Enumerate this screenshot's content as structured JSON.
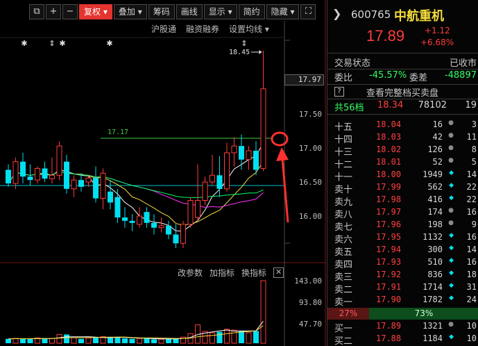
{
  "toolbar": {
    "buttons": [
      "+",
      "−",
      "复权",
      "叠加",
      "筹码",
      "画线",
      "显示",
      "简约",
      "隐藏"
    ],
    "active": "复权"
  },
  "sub_toolbar": [
    "沪股通",
    "融资融券",
    "设置均线"
  ],
  "indicator_toolbar": [
    "改参数",
    "加指标",
    "换指标"
  ],
  "chart": {
    "high_label": "18.45",
    "ma_label": "17.17",
    "price_tag": "17.97",
    "price_axis": [
      "17.50",
      "17.00",
      "16.50",
      "16.00"
    ],
    "volume_axis": [
      "143.00",
      "93.80",
      "47.70"
    ],
    "candles": [
      {
        "o": 16.7,
        "h": 16.78,
        "l": 16.45,
        "c": 16.5
      },
      {
        "o": 16.5,
        "h": 16.88,
        "l": 16.42,
        "c": 16.82
      },
      {
        "o": 16.82,
        "h": 16.95,
        "l": 16.5,
        "c": 16.6
      },
      {
        "o": 16.6,
        "h": 16.78,
        "l": 16.47,
        "c": 16.55
      },
      {
        "o": 16.55,
        "h": 16.75,
        "l": 16.5,
        "c": 16.72
      },
      {
        "o": 16.72,
        "h": 16.82,
        "l": 16.52,
        "c": 16.57
      },
      {
        "o": 16.57,
        "h": 16.88,
        "l": 16.5,
        "c": 16.62
      },
      {
        "o": 16.62,
        "h": 17.12,
        "l": 16.55,
        "c": 17.05
      },
      {
        "o": 16.82,
        "h": 16.92,
        "l": 16.35,
        "c": 16.42
      },
      {
        "o": 16.42,
        "h": 16.62,
        "l": 16.3,
        "c": 16.55
      },
      {
        "o": 16.55,
        "h": 16.65,
        "l": 16.38,
        "c": 16.45
      },
      {
        "o": 16.52,
        "h": 16.62,
        "l": 16.45,
        "c": 16.58
      },
      {
        "o": 16.58,
        "h": 16.75,
        "l": 16.22,
        "c": 16.28
      },
      {
        "o": 16.28,
        "h": 16.72,
        "l": 16.12,
        "c": 16.65
      },
      {
        "o": 16.38,
        "h": 16.55,
        "l": 16.12,
        "c": 16.22
      },
      {
        "o": 16.3,
        "h": 16.42,
        "l": 15.92,
        "c": 16.0
      },
      {
        "o": 16.0,
        "h": 16.15,
        "l": 15.85,
        "c": 15.95
      },
      {
        "o": 15.95,
        "h": 16.05,
        "l": 15.8,
        "c": 15.92
      },
      {
        "o": 15.9,
        "h": 16.15,
        "l": 15.85,
        "c": 16.02
      },
      {
        "o": 16.08,
        "h": 16.15,
        "l": 15.85,
        "c": 15.92
      },
      {
        "o": 15.92,
        "h": 16.05,
        "l": 15.75,
        "c": 15.85
      },
      {
        "o": 15.85,
        "h": 16.0,
        "l": 15.78,
        "c": 15.88
      },
      {
        "o": 15.88,
        "h": 15.95,
        "l": 15.68,
        "c": 15.75
      },
      {
        "o": 15.75,
        "h": 15.9,
        "l": 15.55,
        "c": 15.62
      },
      {
        "o": 15.62,
        "h": 15.95,
        "l": 15.55,
        "c": 15.9
      },
      {
        "o": 15.9,
        "h": 16.3,
        "l": 15.85,
        "c": 16.25
      },
      {
        "o": 16.0,
        "h": 16.78,
        "l": 15.95,
        "c": 16.25
      },
      {
        "o": 16.25,
        "h": 16.6,
        "l": 16.18,
        "c": 16.52
      },
      {
        "o": 16.52,
        "h": 16.92,
        "l": 16.48,
        "c": 16.62
      },
      {
        "o": 16.62,
        "h": 16.9,
        "l": 16.3,
        "c": 16.42
      },
      {
        "o": 16.42,
        "h": 17.1,
        "l": 16.38,
        "c": 16.95
      },
      {
        "o": 16.95,
        "h": 17.18,
        "l": 16.75,
        "c": 17.05
      },
      {
        "o": 17.05,
        "h": 17.22,
        "l": 16.7,
        "c": 16.85
      },
      {
        "o": 16.85,
        "h": 17.05,
        "l": 16.7,
        "c": 16.98
      },
      {
        "o": 16.98,
        "h": 17.12,
        "l": 16.62,
        "c": 16.7
      },
      {
        "o": 16.72,
        "h": 18.45,
        "l": 16.68,
        "c": 17.89
      }
    ],
    "volumes": [
      10,
      11,
      10,
      10,
      12,
      10,
      11,
      20,
      20,
      13,
      10,
      12,
      14,
      15,
      13,
      14,
      11,
      10,
      11,
      11,
      9,
      9,
      10,
      11,
      14,
      22,
      42,
      27,
      24,
      26,
      32,
      30,
      28,
      24,
      28,
      143
    ]
  },
  "sidebar": {
    "code": "600765",
    "name": "中航重机",
    "price": "17.89",
    "change": "+1.12",
    "change_pct": "+6.68%",
    "status_label": "交易状态",
    "status_value": "已收市",
    "weibi_label": "委比",
    "weibi_value": "-45.57%",
    "weicha_label": "委差",
    "weicha_value": "-48897",
    "full_book_label": "查看完整档买卖盘",
    "levels_label": "共56档",
    "levels_price": "18.34",
    "levels_vol": "78102",
    "levels_cnt": "19",
    "ask": [
      {
        "label": "十五",
        "price": "18.04",
        "vol": "16",
        "mark": "●",
        "cnt": "3"
      },
      {
        "label": "十四",
        "price": "18.03",
        "vol": "42",
        "mark": "●",
        "cnt": "11"
      },
      {
        "label": "十三",
        "price": "18.02",
        "vol": "126",
        "mark": "●",
        "cnt": "8"
      },
      {
        "label": "十二",
        "price": "18.01",
        "vol": "52",
        "mark": "●",
        "cnt": "5"
      },
      {
        "label": "十一",
        "price": "18.00",
        "vol": "1949",
        "mark": "◆",
        "cnt": "14"
      },
      {
        "label": "卖十",
        "price": "17.99",
        "vol": "562",
        "mark": "◆",
        "cnt": "22"
      },
      {
        "label": "卖九",
        "price": "17.98",
        "vol": "416",
        "mark": "◆",
        "cnt": "22"
      },
      {
        "label": "卖八",
        "price": "17.97",
        "vol": "174",
        "mark": "●",
        "cnt": "16"
      },
      {
        "label": "卖七",
        "price": "17.96",
        "vol": "198",
        "mark": "●",
        "cnt": "9"
      },
      {
        "label": "卖六",
        "price": "17.95",
        "vol": "1132",
        "mark": "◆",
        "cnt": "16"
      },
      {
        "label": "卖五",
        "price": "17.94",
        "vol": "300",
        "mark": "◆",
        "cnt": "14"
      },
      {
        "label": "卖四",
        "price": "17.93",
        "vol": "510",
        "mark": "◆",
        "cnt": "16"
      },
      {
        "label": "卖三",
        "price": "17.92",
        "vol": "836",
        "mark": "◆",
        "cnt": "18"
      },
      {
        "label": "卖二",
        "price": "17.91",
        "vol": "1714",
        "mark": "◆",
        "cnt": "31"
      },
      {
        "label": "卖一",
        "price": "17.90",
        "vol": "1782",
        "mark": "◆",
        "cnt": "24"
      }
    ],
    "ratio_left": "27%",
    "ratio_right": "73%",
    "bid": [
      {
        "label": "买一",
        "price": "17.89",
        "vol": "1321",
        "mark": "●",
        "cnt": "10"
      },
      {
        "label": "买二",
        "price": "17.88",
        "vol": "1184",
        "mark": "◆",
        "cnt": "10"
      }
    ]
  },
  "colors": {
    "up": "#ff3c3c",
    "down": "#00e0f0",
    "ma5": "#ffffff",
    "ma10": "#f5dc3c",
    "ma20": "#ff33ff",
    "ma30": "#00ff66",
    "annotation": "#ff3030",
    "green_text": "#33ff66",
    "mark_cyan": "#00e0f0",
    "mark_grey": "#8a8a8a"
  }
}
